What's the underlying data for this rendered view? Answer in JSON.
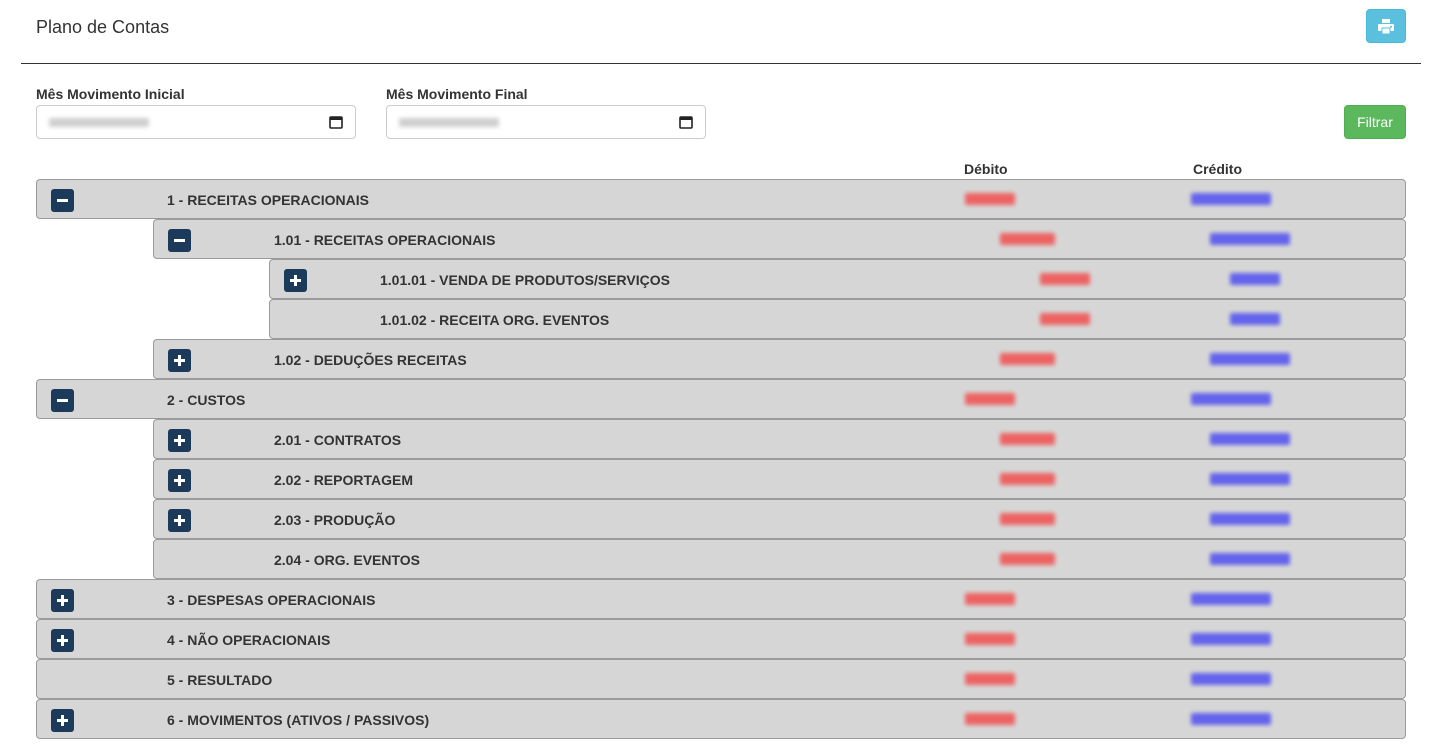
{
  "header": {
    "title": "Plano de Contas",
    "print_icon": "print-icon"
  },
  "filters": {
    "start_label": "Mês Movimento Inicial",
    "end_label": "Mês Movimento Final",
    "filter_button": "Filtrar",
    "calendar_icon": "calendar-icon"
  },
  "columns": {
    "debit": "Débito",
    "credit": "Crédito"
  },
  "colors": {
    "debit": "#f25050",
    "credit": "#4f4ff0",
    "toggle": "#1c3a5a",
    "filter": "#5cb85c",
    "print": "#5bc0de"
  },
  "rows": [
    {
      "label": "1 - RECEITAS OPERACIONAIS",
      "level": 0,
      "toggle": "minus"
    },
    {
      "label": "1.01 - RECEITAS OPERACIONAIS",
      "level": 1,
      "toggle": "minus"
    },
    {
      "label": "1.01.01 - VENDA DE PRODUTOS/SERVIÇOS",
      "level": 2,
      "toggle": "plus"
    },
    {
      "label": "1.01.02 - RECEITA ORG. EVENTOS",
      "level": 2,
      "toggle": "none"
    },
    {
      "label": "1.02 - DEDUÇÕES RECEITAS",
      "level": 1,
      "toggle": "plus"
    },
    {
      "label": "2 - CUSTOS",
      "level": 0,
      "toggle": "minus"
    },
    {
      "label": "2.01 - CONTRATOS",
      "level": 1,
      "toggle": "plus"
    },
    {
      "label": "2.02 - REPORTAGEM",
      "level": 1,
      "toggle": "plus"
    },
    {
      "label": "2.03 - PRODUÇÃO",
      "level": 1,
      "toggle": "plus"
    },
    {
      "label": "2.04 - ORG. EVENTOS",
      "level": 1,
      "toggle": "none"
    },
    {
      "label": "3 - DESPESAS OPERACIONAIS",
      "level": 0,
      "toggle": "plus"
    },
    {
      "label": "4 - NÃO OPERACIONAIS",
      "level": 0,
      "toggle": "plus"
    },
    {
      "label": "5 - RESULTADO",
      "level": 0,
      "toggle": "none"
    },
    {
      "label": "6 - MOVIMENTOS (ATIVOS / PASSIVOS)",
      "level": 0,
      "toggle": "plus"
    }
  ]
}
